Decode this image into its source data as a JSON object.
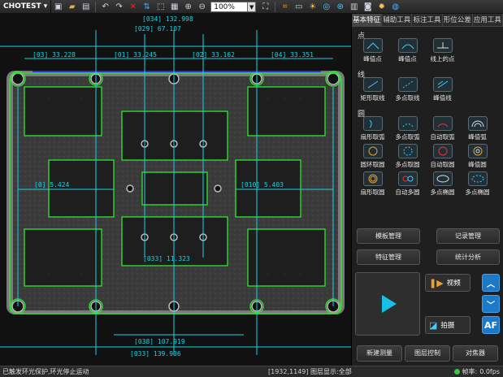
{
  "app": {
    "name": "CHOTEST"
  },
  "toolbar": {
    "zoom": "100%",
    "icons": [
      "save-icon",
      "open-icon",
      "export-icon",
      "undo-icon",
      "redo-icon",
      "delete-icon",
      "sort-icon",
      "select-icon",
      "grid-icon",
      "zoom-in-icon",
      "zoom-out-icon",
      "fit-icon",
      "measure-icon",
      "camera-icon",
      "globe-icon"
    ]
  },
  "tabs": [
    "基本特征",
    "辅助工具",
    "标注工具",
    "形位公差",
    "应用工具"
  ],
  "sections": {
    "point": {
      "title": "点",
      "tools": [
        "峰值点",
        "峰值点",
        "线上的点"
      ]
    },
    "line": {
      "title": "线",
      "tools": [
        "矩形取线",
        "多点取线",
        "峰值线"
      ]
    },
    "circle": {
      "title": "圆",
      "tools": [
        "扇形取弧",
        "多点取弧",
        "自动取弧",
        "峰值弧",
        "圆环取圆",
        "多点取圆",
        "自动取圆",
        "峰值圆",
        "扇形取圆",
        "自动多圆",
        "多点椭圆",
        "多点椭圆"
      ]
    }
  },
  "buttons": {
    "template": "模板管理",
    "record": "记录管理",
    "feature": "特征管理",
    "stats": "统计分析",
    "video": "视频",
    "capture": "拍摄",
    "auto_focus": "AF",
    "new_measure": "新建测量",
    "layer_ctrl": "图层控制",
    "focus": "对焦器"
  },
  "status": {
    "message": "已触发环光保护,环光停止运动",
    "coords": "[1932,1149]",
    "layer": "图层显示:全部",
    "fps_label": "帧率:",
    "fps": "0.0fps"
  },
  "dimensions": [
    {
      "id": "[034]",
      "value": "132.998"
    },
    {
      "id": "[029]",
      "value": "67.107"
    },
    {
      "id": "[03]",
      "value": "33.228"
    },
    {
      "id": "[01]",
      "value": "33.245"
    },
    {
      "id": "[02]",
      "value": "33.162"
    },
    {
      "id": "[04]",
      "value": "33.351"
    },
    {
      "id": "[0]",
      "value": "5.424"
    },
    {
      "id": "[010]",
      "value": "5.403"
    },
    {
      "id": "[033]",
      "value": "11.323"
    },
    {
      "id": "[038]",
      "value": "107.919"
    },
    {
      "id": "[033]",
      "value": "139.906"
    }
  ]
}
